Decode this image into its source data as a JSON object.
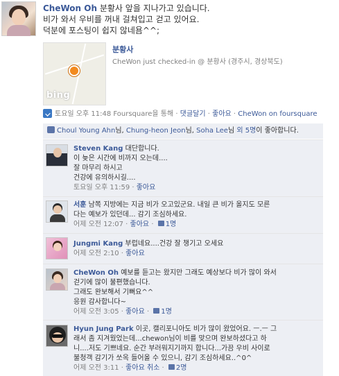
{
  "post": {
    "author": "CheWon Oh",
    "lines": [
      "분황사 앞을 지나가고 있습니다.",
      "비가 와서 우비를 꺼내 걸쳐입고 걷고 있어요.",
      "덕분에 포스팅이 쉽지 않네욤^^;"
    ],
    "place": {
      "name": "분황사",
      "checkin_text": "CheWon just checked-in @ 분황사 (경주시, 경상북도)",
      "map_brand": "bing"
    },
    "meta": {
      "timestamp": "토요일 오후 11:48",
      "via": "Foursquare을 통해",
      "comment_link": "댓글달기",
      "like_link": "좋아요",
      "app_link": "CheWon on foursquare",
      "sep": "·"
    }
  },
  "likes": {
    "user1": "Choul Young Ahn",
    "suffix1": "님, ",
    "user2": "Chung-heon Jeon",
    "suffix2": "님, ",
    "user3": "Soha Lee",
    "suffix3": "님 ",
    "others": "외 5명",
    "tail": "이 좋아합니다."
  },
  "comments": [
    {
      "name": "Steven Kang",
      "lines": [
        "대단합니다.",
        "이 늦은 시간에 비까지 오는데....",
        "잘 마무리 하시고",
        "건강에 유의하시길...."
      ],
      "time": "토요일 오후 11:59",
      "like": "좋아요",
      "like_count": ""
    },
    {
      "name": "서훈",
      "lines": [
        "남쪽 지방에는 지금 비가 오고있군요. 내일 큰 비가 올지도 모른",
        "다는 예보가 있던데... 감기 조심하세요."
      ],
      "time": "어제 오전 12:07",
      "like": "좋아요",
      "like_count": "1명"
    },
    {
      "name": "Jungmi Kang",
      "lines": [
        "부럽네요....건강 잘 챙기고 오세요"
      ],
      "time": "어제 오전 2:10",
      "like": "좋아요",
      "like_count": ""
    },
    {
      "name": "CheWon Oh",
      "lines": [
        "예보를 듣고는 왔지만 그래도 예상보다 비가 많이 와서",
        "걷기에 많이 불편했습니다.",
        "그래도 완보해서 기뻐요^^",
        "응원 감사합니다~"
      ],
      "time": "어제 오전 3:05",
      "like": "좋아요",
      "like_count": "1명"
    },
    {
      "name": "Hyun Jung Park",
      "lines": [
        "이곳, 캘리포니아도 비가 많이 왔었어요. ㅡ.ㅡ 그",
        "래서 좀 지겨웠었는데...chewon님이 비를 맞으며 완보하셨다고 하",
        "니....저도 기쁘네요. 순간 부러워지기까지 합니다...가끔 우비 사이로",
        "불청객 감기가 쏘옥 들어올 수 있으니, 감기 조심하세요..^0^"
      ],
      "time": "어제 오전 3:11",
      "like": "좋아요",
      "unlike": "취소",
      "like_count": "2명"
    }
  ]
}
